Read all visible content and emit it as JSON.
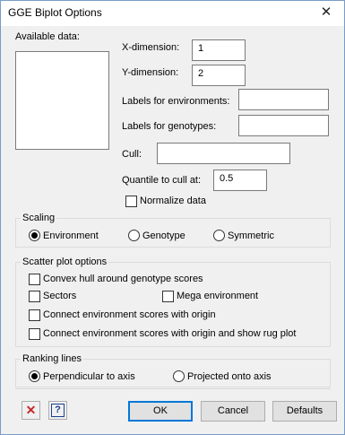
{
  "window": {
    "title": "GGE Biplot Options",
    "close_glyph": "✕"
  },
  "available_data": {
    "label": "Available data:"
  },
  "fields": {
    "x_dimension": {
      "label": "X-dimension:",
      "value": "1"
    },
    "y_dimension": {
      "label": "Y-dimension:",
      "value": "2"
    },
    "labels_env": {
      "label": "Labels for environments:",
      "value": ""
    },
    "labels_geno": {
      "label": "Labels for genotypes:",
      "value": ""
    },
    "cull": {
      "label": "Cull:",
      "value": ""
    },
    "quantile": {
      "label": "Quantile to cull at:",
      "value": "0.5"
    }
  },
  "normalize": {
    "label": "Normalize data",
    "checked": false
  },
  "scaling": {
    "title": "Scaling",
    "options": [
      "Environment",
      "Genotype",
      "Symmetric"
    ],
    "selected": "Environment"
  },
  "scatter": {
    "title": "Scatter plot options",
    "convex_hull": "Convex hull around genotype scores",
    "sectors": "Sectors",
    "mega": "Mega environment",
    "connect": "Connect environment scores with origin",
    "connect_rug": "Connect environment scores with origin and show rug plot"
  },
  "ranking": {
    "title": "Ranking lines",
    "options": [
      "Perpendicular to axis",
      "Projected onto axis"
    ],
    "selected": "Perpendicular to axis"
  },
  "buttons": {
    "clear_glyph": "✕",
    "help_glyph": "?",
    "ok": "OK",
    "cancel": "Cancel",
    "defaults": "Defaults"
  },
  "colors": {
    "clear_icon": "#c62828",
    "help_icon": "#1a3f8f"
  }
}
